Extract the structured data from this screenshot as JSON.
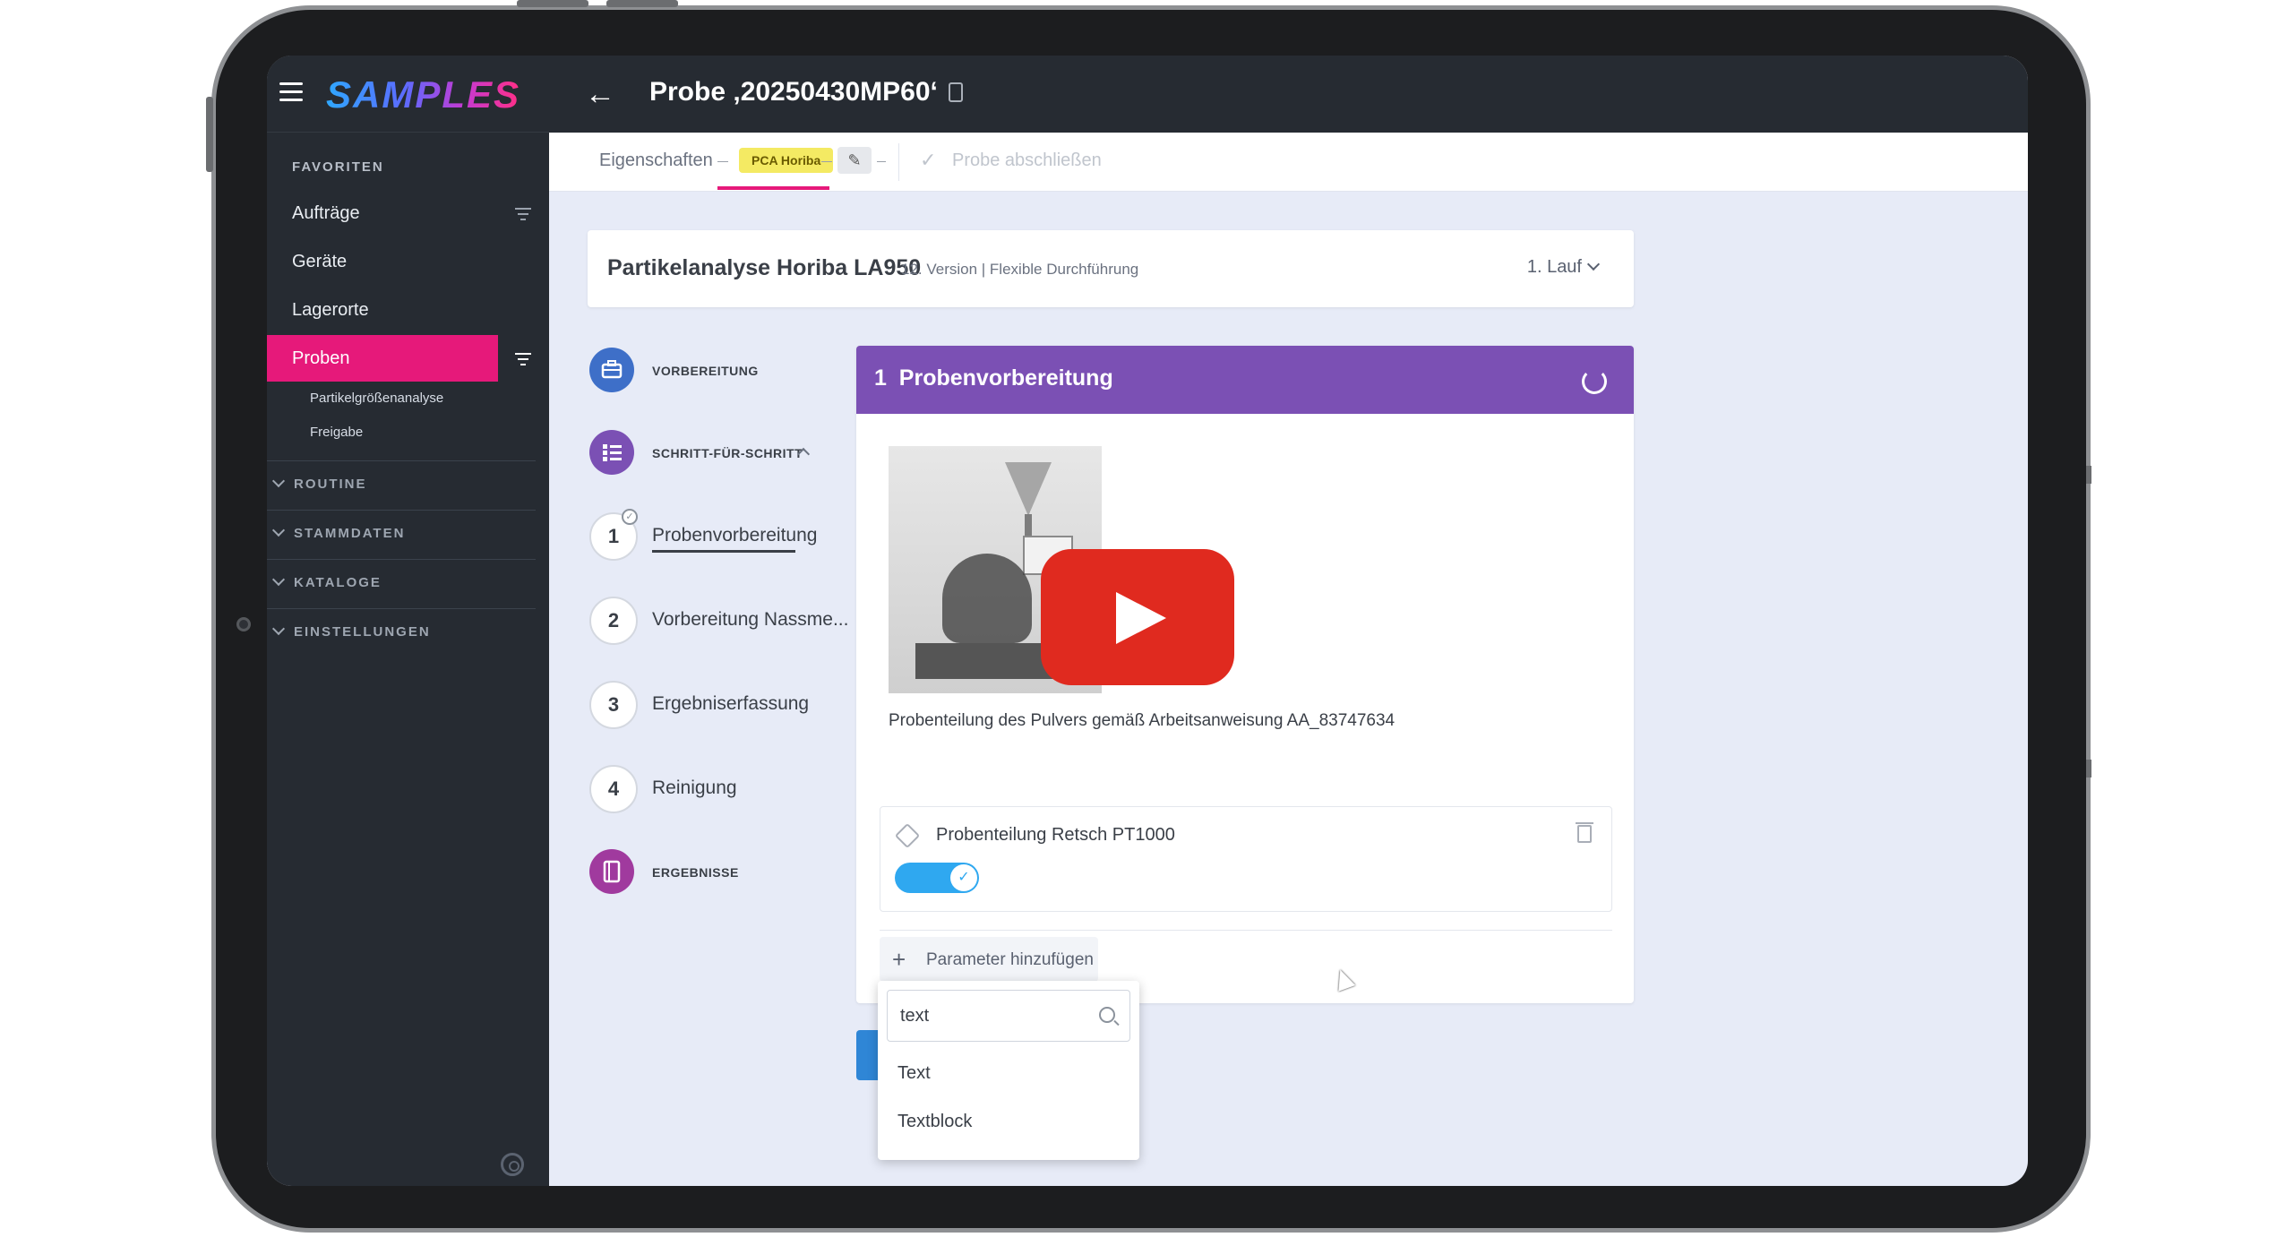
{
  "app": {
    "logo_text": "SAMPLES",
    "page_title": "Probe ‚20250430MP60‘"
  },
  "sidebar": {
    "favorites_label": "FAVORITEN",
    "items": [
      {
        "label": "Aufträge"
      },
      {
        "label": "Geräte"
      },
      {
        "label": "Lagerorte"
      },
      {
        "label": "Proben"
      }
    ],
    "sub_items": [
      {
        "label": "Partikelgrößenanalyse"
      },
      {
        "label": "Freigabe"
      }
    ],
    "groups": [
      {
        "label": "ROUTINE"
      },
      {
        "label": "STAMMDATEN"
      },
      {
        "label": "KATALOGE"
      },
      {
        "label": "EINSTELLUNGEN"
      }
    ]
  },
  "tabs": {
    "properties": "Eigenschaften",
    "badge": "PCA Horiba",
    "finish": "Probe abschließen"
  },
  "method": {
    "title": "Partikelanalyse Horiba LA950",
    "subtitle": "12. Version | Flexible Durchführung",
    "run": "1. Lauf"
  },
  "nav": {
    "preparation": "VORBEREITUNG",
    "step_by_step": "SCHRITT-FÜR-SCHRITT",
    "results": "ERGEBNISSE",
    "steps": [
      {
        "num": "1",
        "label": "Probenvorbereitung"
      },
      {
        "num": "2",
        "label": "Vorbereitung Nassme..."
      },
      {
        "num": "3",
        "label": "Ergebniserfassung"
      },
      {
        "num": "4",
        "label": "Reinigung"
      }
    ]
  },
  "step_card": {
    "header": "1  Probenvorbereitung",
    "caption": "Probenteilung des Pulvers gemäß Arbeitsanweisung AA_83747634",
    "parameter_name": "Probenteilung Retsch PT1000",
    "toggle_on": true,
    "add_parameter": "Parameter hinzufügen"
  },
  "dropdown": {
    "search_value": "text",
    "options": [
      "Text",
      "Textblock"
    ]
  },
  "colors": {
    "accent_pink": "#e6197a",
    "step_header_purple": "#7b50b4",
    "toggle_blue": "#2fa8f0",
    "sidebar_bg": "#262b32",
    "youtube_red": "#e02a1f"
  }
}
